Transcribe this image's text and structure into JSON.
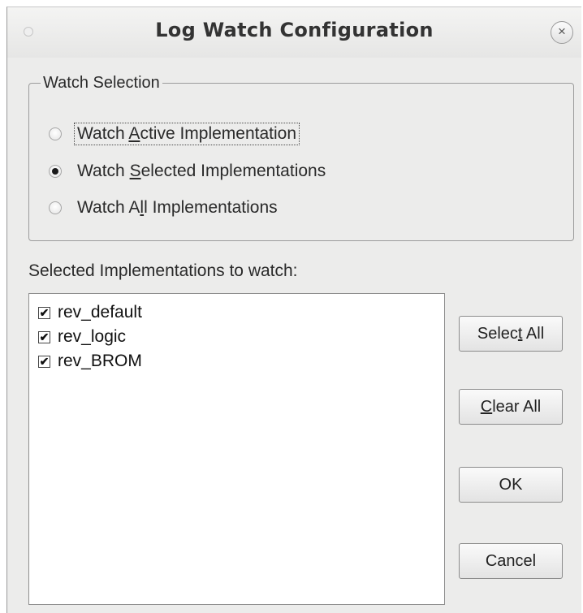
{
  "window": {
    "title": "Log Watch Configuration"
  },
  "watch_selection": {
    "legend": "Watch Selection",
    "options": [
      {
        "pre": "Watch ",
        "mnemonic": "A",
        "post": "ctive Implementation",
        "checked": false,
        "focused": true
      },
      {
        "pre": "Watch ",
        "mnemonic": "S",
        "post": "elected Implementations",
        "checked": true,
        "focused": false
      },
      {
        "pre": "Watch A",
        "mnemonic": "l",
        "post": "l Implementations",
        "checked": false,
        "focused": false
      }
    ]
  },
  "implementations": {
    "label": "Selected Implementations to watch:",
    "items": [
      {
        "name": "rev_default",
        "checked": true
      },
      {
        "name": "rev_logic",
        "checked": true
      },
      {
        "name": "rev_BROM",
        "checked": true
      }
    ]
  },
  "buttons": {
    "select_all": {
      "pre": "Selec",
      "mnemonic": "t",
      "post": " All"
    },
    "clear_all": {
      "pre": "",
      "mnemonic": "C",
      "post": "lear All"
    },
    "ok": "OK",
    "cancel": "Cancel"
  },
  "icons": {
    "check_glyph": "✔",
    "close_glyph": "×"
  }
}
